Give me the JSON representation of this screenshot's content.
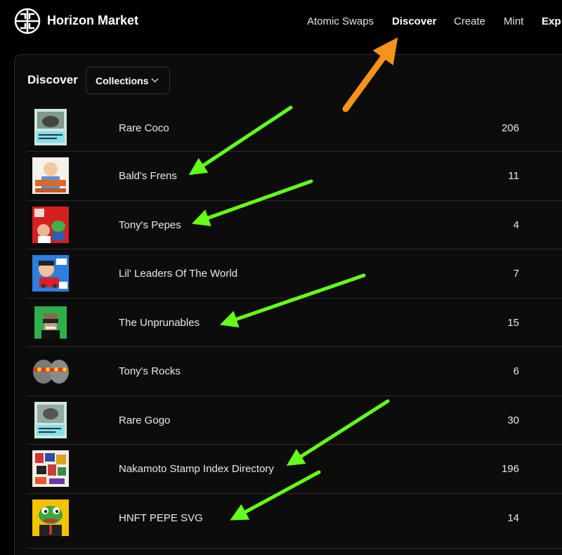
{
  "header": {
    "brand": "Horizon Market",
    "logo_icon": "horizon-market-logo-icon",
    "nav": [
      {
        "label": "Atomic Swaps",
        "active": false
      },
      {
        "label": "Discover",
        "active": true
      },
      {
        "label": "Create",
        "active": false
      },
      {
        "label": "Mint",
        "active": false
      },
      {
        "label": "Exp",
        "active": false
      }
    ]
  },
  "discover": {
    "title": "Discover",
    "filter": {
      "selected": "Collections",
      "icon": "chevron-down-icon"
    }
  },
  "collections": [
    {
      "name": "Rare Coco",
      "count": "206"
    },
    {
      "name": "Bald's Frens",
      "count": "11"
    },
    {
      "name": "Tony's Pepes",
      "count": "4"
    },
    {
      "name": "Lil' Leaders Of The World",
      "count": "7"
    },
    {
      "name": "The Unprunables",
      "count": "15"
    },
    {
      "name": "Tony's Rocks",
      "count": "6"
    },
    {
      "name": "Rare Gogo",
      "count": "30"
    },
    {
      "name": "Nakamoto Stamp Index Directory",
      "count": "196"
    },
    {
      "name": "HNFT PEPE SVG",
      "count": "14"
    }
  ],
  "annotation_colors": {
    "orange_arrow": "#f7931a",
    "green_arrow": "#66ff1a"
  }
}
